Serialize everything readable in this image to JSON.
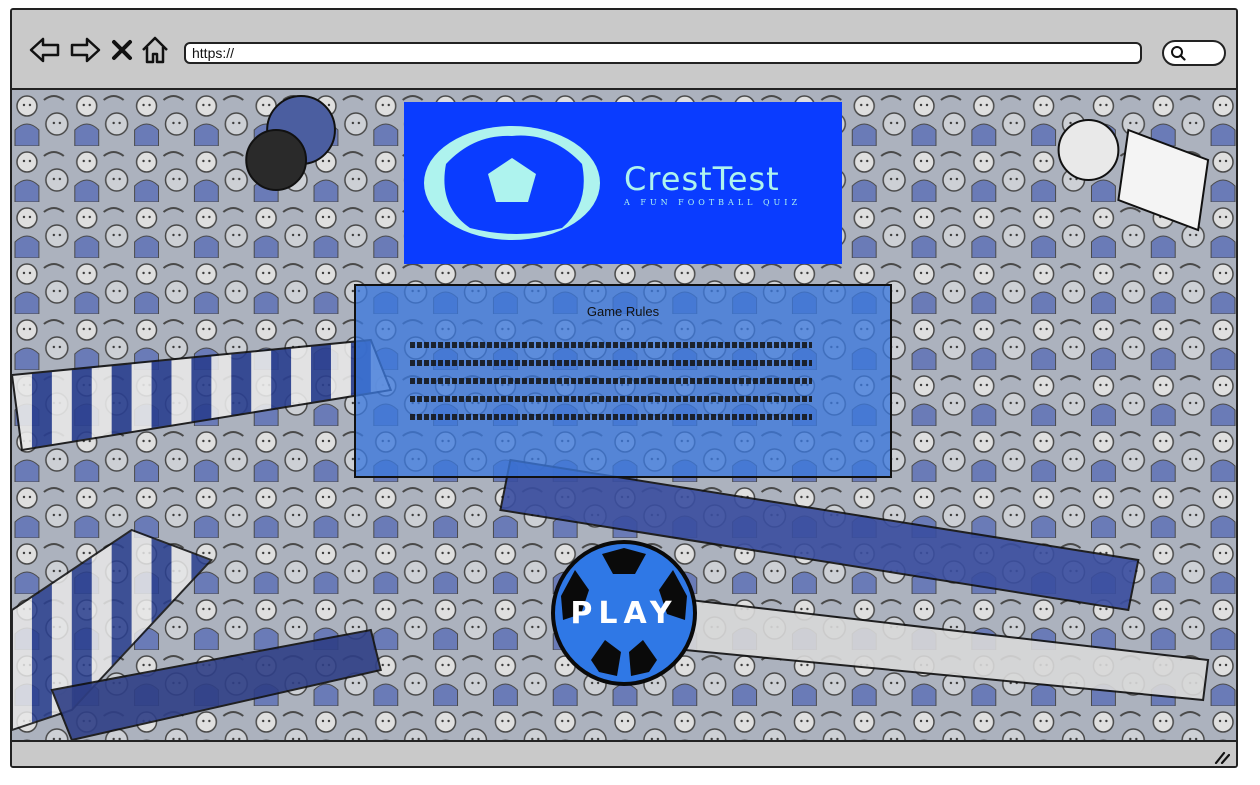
{
  "browser": {
    "url": "https://",
    "icons": [
      "back-arrow-icon",
      "forward-arrow-icon",
      "close-icon",
      "home-icon",
      "search-icon",
      "resize-grip-icon"
    ]
  },
  "logo": {
    "title": "CrestTest",
    "tagline": "A FUN FOOTBALL QUIZ",
    "colors": {
      "banner": "#0a3cff",
      "accent": "#aef3ee"
    }
  },
  "rules": {
    "title": "Game Rules"
  },
  "play": {
    "label": "PLAY",
    "colors": {
      "ball": "#2f78e6",
      "dark": "#0a0a0a"
    }
  }
}
